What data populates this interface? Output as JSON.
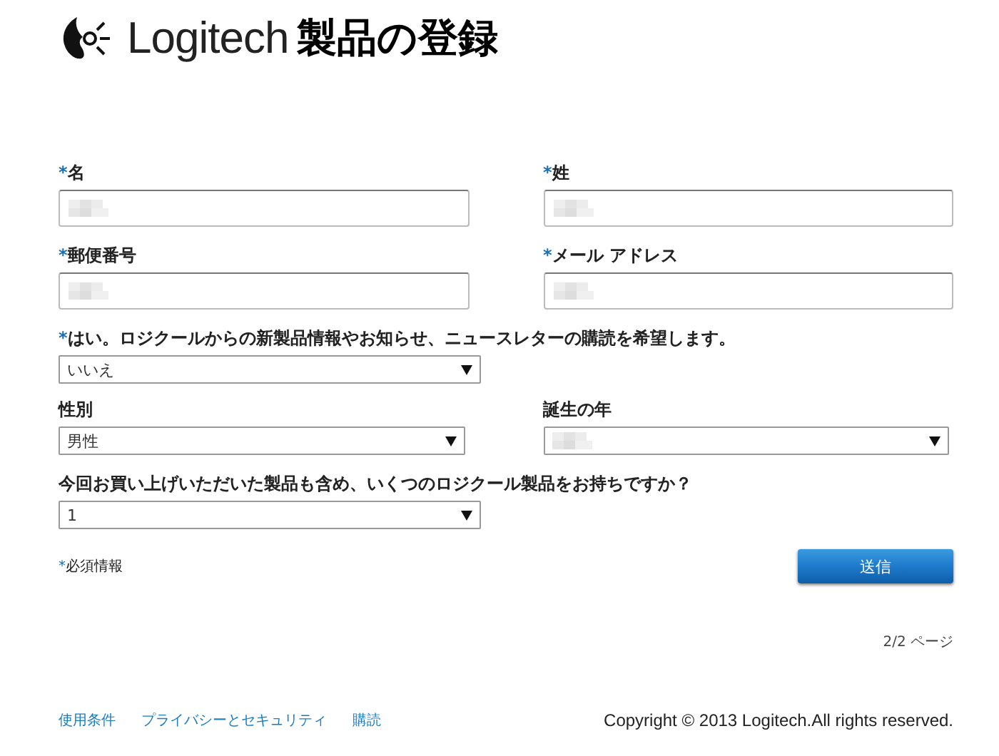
{
  "header": {
    "brand": "Logitech",
    "title": "製品の登録"
  },
  "form": {
    "required_mark": "*",
    "rows": [
      {
        "fields": [
          {
            "kind": "input",
            "label": "名",
            "required": true,
            "redacted": true
          },
          {
            "kind": "input",
            "label": "姓",
            "required": true,
            "redacted": true
          }
        ]
      },
      {
        "fields": [
          {
            "kind": "input",
            "label": "郵便番号",
            "required": true,
            "redacted": true
          },
          {
            "kind": "input",
            "label": "メール アドレス",
            "required": true,
            "redacted": true
          }
        ]
      },
      {
        "fields": [
          {
            "kind": "select",
            "label": "はい。ロジクールからの新製品情報やお知らせ、ニュースレターの購読を希望します。",
            "required": true,
            "value": "いいえ"
          }
        ]
      },
      {
        "fields": [
          {
            "kind": "select",
            "label": "性別",
            "required": false,
            "value": "男性"
          },
          {
            "kind": "select",
            "label": "誕生の年",
            "required": false,
            "redacted": true
          }
        ]
      },
      {
        "fields": [
          {
            "kind": "select",
            "label": "今回お買い上げいただいた製品も含め、いくつのロジクール製品をお持ちですか？",
            "required": false,
            "value": "1"
          }
        ]
      }
    ],
    "required_note": "必須情報",
    "submit": "送信",
    "page_indicator": "2/2 ページ"
  },
  "footer": {
    "links": [
      "使用条件",
      "プライバシーとセキュリティ",
      "購読"
    ],
    "copyright": "Copyright © 2013 Logitech.All rights reserved."
  }
}
